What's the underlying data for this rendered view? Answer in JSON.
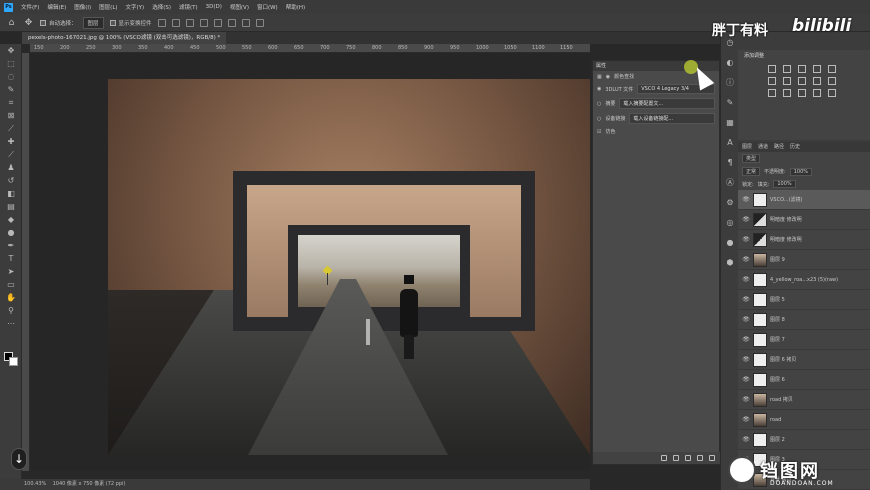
{
  "menubar": {
    "app_icon": "Ps",
    "items": [
      "文件(F)",
      "编辑(E)",
      "图像(I)",
      "图层(L)",
      "文字(Y)",
      "选择(S)",
      "滤镜(T)",
      "3D(D)",
      "视图(V)",
      "窗口(W)",
      "帮助(H)"
    ]
  },
  "options_bar": {
    "auto_select_label": "自动选择：",
    "auto_select_value": "图层",
    "transform_label": "显示变换控件"
  },
  "document": {
    "tab_label": "pexels-photo-167021.jpg @ 100% (VSCO滤镜 (双击可选滤镜)，RGB/8) *"
  },
  "ruler": {
    "ticks": [
      "150",
      "200",
      "250",
      "300",
      "350",
      "400",
      "450",
      "500",
      "550",
      "600",
      "650",
      "700",
      "750",
      "800",
      "850",
      "900",
      "950",
      "1000",
      "1050",
      "1100",
      "1150"
    ]
  },
  "properties_panel": {
    "tab": "属性",
    "subtitle": "颜色查找",
    "rows": [
      {
        "label": "3DLUT 文件",
        "value": "VSCO 4 Legacy 3/4"
      },
      {
        "label": "摘要",
        "value": "载入摘要配置文..."
      },
      {
        "label": "设备链接",
        "value": "载入设备链接配..."
      },
      {
        "label": "仿色",
        "value": ""
      }
    ]
  },
  "adjustments_panel": {
    "title": "添加调整"
  },
  "layers_panel": {
    "tabs": [
      "图层",
      "通道",
      "路径",
      "历史"
    ],
    "search_kind": "类型",
    "blend_mode": "正常",
    "opacity_label": "不透明度:",
    "opacity_value": "100%",
    "lock_label": "锁定:",
    "fill_label": "填充:",
    "fill_value": "100%",
    "layers": [
      {
        "name": "VSCO...(滤镜)",
        "thumb": "w",
        "selected": true
      },
      {
        "name": "明暗度 修改明",
        "thumb": "d"
      },
      {
        "name": "明暗度 修改明",
        "thumb": "d"
      },
      {
        "name": "图层 9",
        "thumb": "img"
      },
      {
        "name": "4_yellow_roa...x23 (5)(raw)",
        "thumb": "w"
      },
      {
        "name": "图层 5",
        "thumb": "w"
      },
      {
        "name": "图层 8",
        "thumb": "w"
      },
      {
        "name": "图层 7",
        "thumb": "w"
      },
      {
        "name": "图层 6 拷贝",
        "thumb": "w"
      },
      {
        "name": "图层 6",
        "thumb": "w"
      },
      {
        "name": "road 拷贝",
        "thumb": "img"
      },
      {
        "name": "road",
        "thumb": "img"
      },
      {
        "name": "图层 2",
        "thumb": "w"
      },
      {
        "name": "图层 3",
        "thumb": "w"
      },
      {
        "name": "背景 拷贝",
        "thumb": "img"
      },
      {
        "name": "图层 1",
        "thumb": "w"
      }
    ]
  },
  "status_bar": {
    "zoom": "100.43%",
    "doc_info": "1040 像素 x 750 像素 (72 ppi)"
  },
  "watermarks": {
    "brand": "胖丁有料",
    "bilibili": "bilibili",
    "site_cn": "铛图网",
    "site_en": "DOANDOAN.COM"
  }
}
